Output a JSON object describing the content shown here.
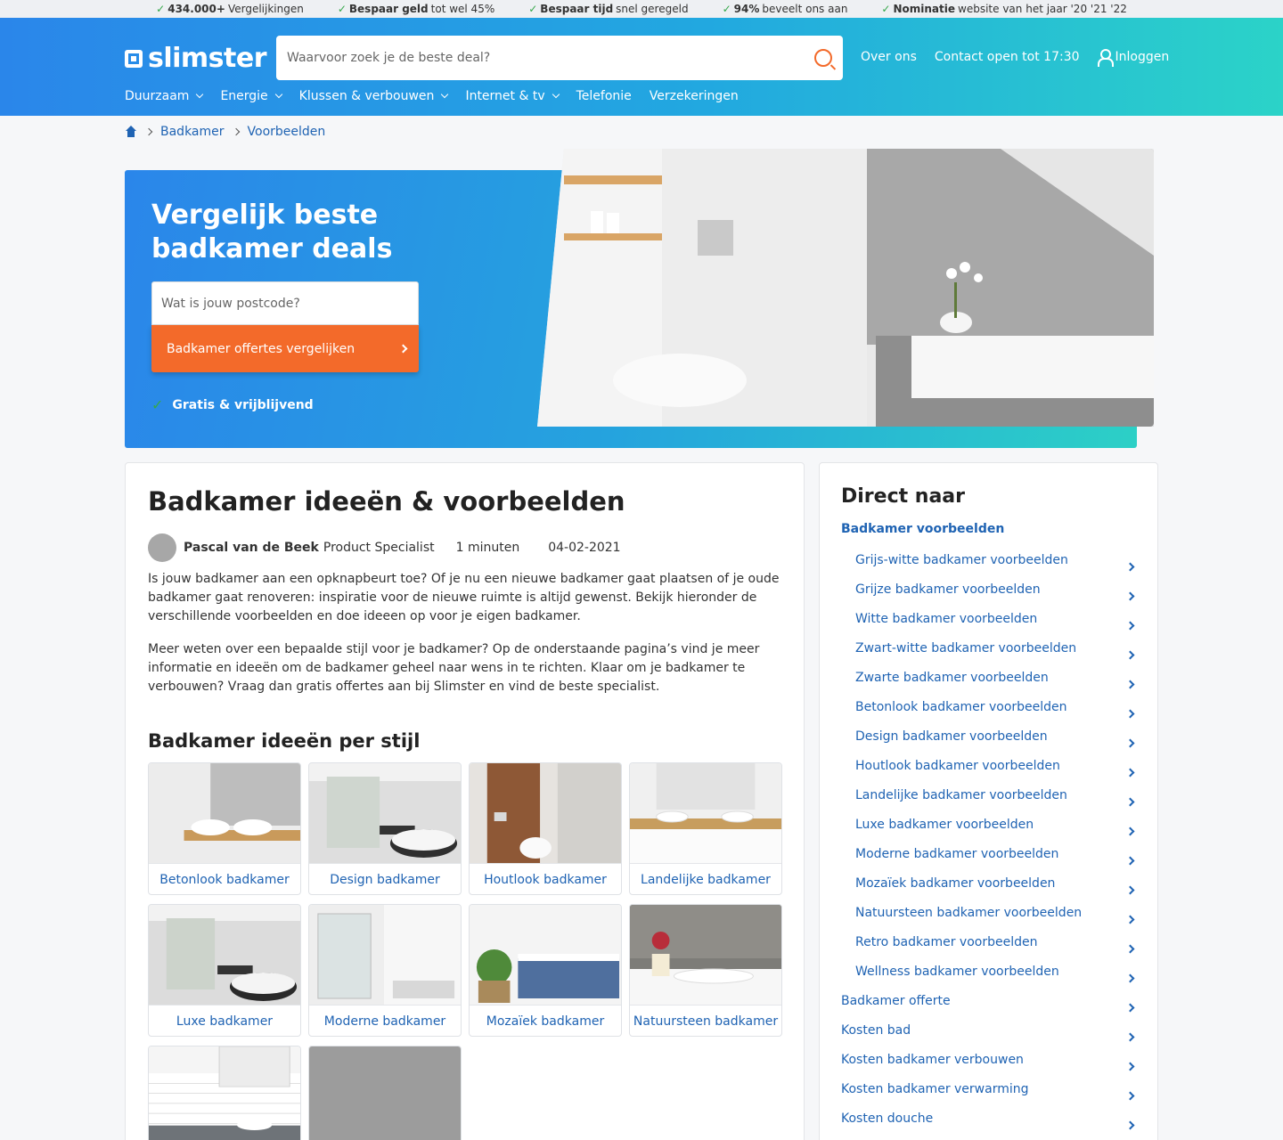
{
  "usp_bar": [
    {
      "bold": "434.000+",
      "text": " Vergelijkingen"
    },
    {
      "bold": "Bespaar geld",
      "text": " tot wel 45%"
    },
    {
      "bold": "Bespaar tijd",
      "text": " snel geregeld"
    },
    {
      "bold": "94%",
      "text": " beveelt ons aan"
    },
    {
      "bold": "Nominatie",
      "text": " website van het jaar '20 '21 '22"
    }
  ],
  "header": {
    "logo_text": "slimster",
    "search_placeholder": "Waarvoor zoek je de beste deal?",
    "about_label": "Over ons",
    "contact_label": "Contact open tot 17:30",
    "login_label": "Inloggen"
  },
  "nav": [
    {
      "label": "Duurzaam",
      "dropdown": true
    },
    {
      "label": "Energie",
      "dropdown": true
    },
    {
      "label": "Klussen & verbouwen",
      "dropdown": true
    },
    {
      "label": "Internet & tv",
      "dropdown": true
    },
    {
      "label": "Telefonie",
      "dropdown": false
    },
    {
      "label": "Verzekeringen",
      "dropdown": false
    }
  ],
  "breadcrumb": [
    "Badkamer",
    "Voorbeelden"
  ],
  "hero": {
    "title": "Vergelijk beste badkamer deals",
    "postcode_placeholder": "Wat is jouw postcode?",
    "cta_label": "Badkamer offertes vergelijken",
    "check_text": "Gratis & vrijblijvend"
  },
  "article": {
    "title": "Badkamer ideeën & voorbeelden",
    "author_name": "Pascal van de Beek",
    "author_role": "Product Specialist",
    "read_time": "1 minuten",
    "date": "04-02-2021",
    "paragraphs": [
      "Is jouw badkamer aan een opknapbeurt toe? Of je nu een nieuwe badkamer gaat plaatsen of je oude badkamer gaat renoveren: inspiratie voor de nieuwe ruimte is altijd gewenst. Bekijk hieronder de verschillende voorbeelden en doe ideeen op voor je eigen badkamer.",
      "Meer weten over een bepaalde stijl voor je badkamer? Op de onderstaande pagina’s vind je meer informatie en ideeën om de badkamer geheel naar wens in te richten. Klaar om je badkamer te verbouwen? Vraag dan gratis offertes aan bij Slimster en vind de beste specialist."
    ],
    "styles_title": "Badkamer ideeën per stijl",
    "style_tiles": [
      "Betonlook badkamer",
      "Design badkamer",
      "Houtlook badkamer",
      "Landelijke badkamer",
      "Luxe badkamer",
      "Moderne badkamer",
      "Mozaïek badkamer",
      "Natuursteen badkamer"
    ]
  },
  "sidebar": {
    "title": "Direct naar",
    "active": "Badkamer voorbeelden",
    "sub_items": [
      "Grijs-witte badkamer voorbeelden",
      "Grijze badkamer voorbeelden",
      "Witte badkamer voorbeelden",
      "Zwart-witte badkamer voorbeelden",
      "Zwarte badkamer voorbeelden",
      "Betonlook badkamer voorbeelden",
      "Design badkamer voorbeelden",
      "Houtlook badkamer voorbeelden",
      "Landelijke badkamer voorbeelden",
      "Luxe badkamer voorbeelden",
      "Moderne badkamer voorbeelden",
      "Mozaïek badkamer voorbeelden",
      "Natuursteen badkamer voorbeelden",
      "Retro badkamer voorbeelden",
      "Wellness badkamer voorbeelden"
    ],
    "items": [
      "Badkamer offerte",
      "Kosten bad",
      "Kosten badkamer verbouwen",
      "Kosten badkamer verwarming",
      "Kosten douche"
    ]
  },
  "colors": {
    "brand_blue": "#2a86ea",
    "brand_teal": "#2cd0c6",
    "cta_orange": "#f36a2a",
    "link_blue": "#1f63b3",
    "check_green": "#35a84a"
  }
}
